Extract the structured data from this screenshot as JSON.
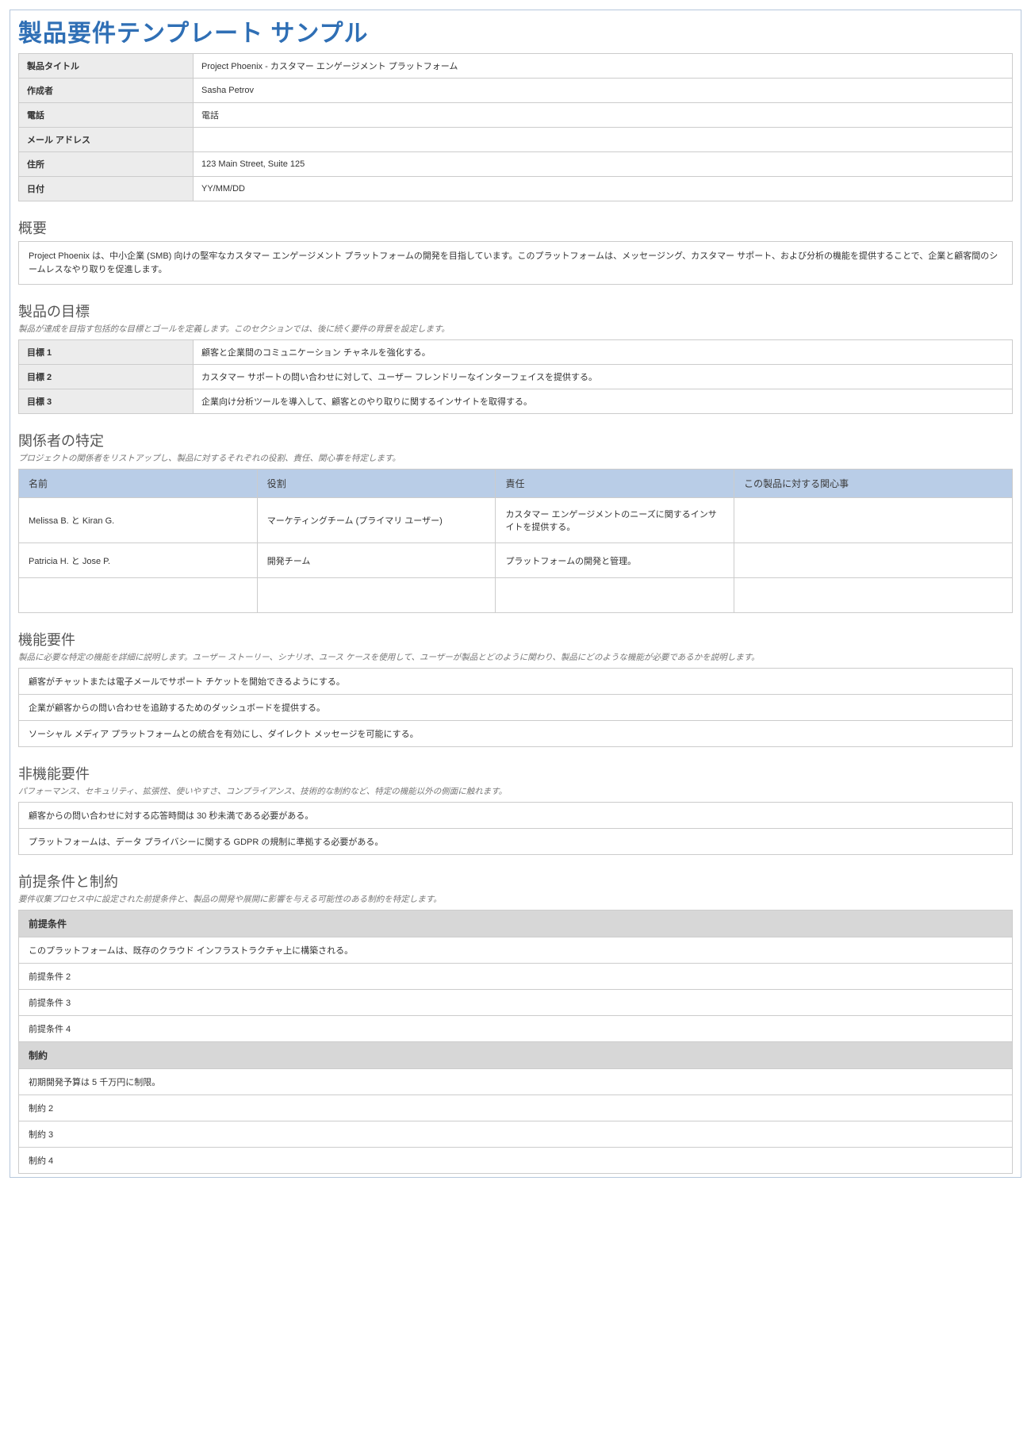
{
  "title": "製品要件テンプレート サンプル",
  "meta": {
    "labels": {
      "product_title": "製品タイトル",
      "author": "作成者",
      "phone": "電話",
      "email": "メール アドレス",
      "address": "住所",
      "date": "日付"
    },
    "values": {
      "product_title": "Project Phoenix - カスタマー エンゲージメント プラットフォーム",
      "author": "Sasha Petrov",
      "phone": "電話",
      "email": "",
      "address": "123 Main Street, Suite 125",
      "date": "YY/MM/DD"
    }
  },
  "overview": {
    "heading": "概要",
    "body": "Project Phoenix は、中小企業 (SMB) 向けの堅牢なカスタマー エンゲージメント プラットフォームの開発を目指しています。このプラットフォームは、メッセージング、カスタマー サポート、および分析の機能を提供することで、企業と顧客間のシームレスなやり取りを促進します。"
  },
  "goals": {
    "heading": "製品の目標",
    "note": "製品が達成を目指す包括的な目標とゴールを定義します。このセクションでは、後に続く要件の背景を設定します。",
    "rows": [
      {
        "label": "目標 1",
        "text": "顧客と企業間のコミュニケーション チャネルを強化する。"
      },
      {
        "label": "目標 2",
        "text": "カスタマー サポートの問い合わせに対して、ユーザー フレンドリーなインターフェイスを提供する。"
      },
      {
        "label": "目標 3",
        "text": "企業向け分析ツールを導入して、顧客とのやり取りに関するインサイトを取得する。"
      }
    ]
  },
  "stakeholders": {
    "heading": "関係者の特定",
    "note": "プロジェクトの関係者をリストアップし、製品に対するそれぞれの役割、責任、関心事を特定します。",
    "columns": {
      "name": "名前",
      "role": "役割",
      "responsibility": "責任",
      "interest": "この製品に対する関心事"
    },
    "rows": [
      {
        "name": "Melissa B. と Kiran G.",
        "role": "マーケティングチーム (プライマリ ユーザー)",
        "responsibility": "カスタマー エンゲージメントのニーズに関するインサイトを提供する。",
        "interest": ""
      },
      {
        "name": "Patricia H. と Jose P.",
        "role": "開発チーム",
        "responsibility": "プラットフォームの開発と管理。",
        "interest": ""
      },
      {
        "name": "",
        "role": "",
        "responsibility": "",
        "interest": ""
      }
    ]
  },
  "functional": {
    "heading": "機能要件",
    "note": "製品に必要な特定の機能を詳細に説明します。ユーザー ストーリー、シナリオ、ユース ケースを使用して、ユーザーが製品とどのように関わり、製品にどのような機能が必要であるかを説明します。",
    "items": [
      "顧客がチャットまたは電子メールでサポート チケットを開始できるようにする。",
      "企業が顧客からの問い合わせを追跡するためのダッシュボードを提供する。",
      "ソーシャル メディア プラットフォームとの統合を有効にし、ダイレクト メッセージを可能にする。"
    ]
  },
  "nonfunctional": {
    "heading": "非機能要件",
    "note": "パフォーマンス、セキュリティ、拡張性、使いやすさ、コンプライアンス、技術的な制約など、特定の機能以外の側面に触れます。",
    "items": [
      "顧客からの問い合わせに対する応答時間は 30 秒未満である必要がある。",
      "プラットフォームは、データ プライバシーに関する GDPR の規制に準拠する必要がある。"
    ]
  },
  "assumptions": {
    "heading": "前提条件と制約",
    "note": "要件収集プロセス中に設定された前提条件と、製品の開発や展開に影響を与える可能性のある制約を特定します。",
    "assumption_header": "前提条件",
    "assumption_items": [
      "このプラットフォームは、既存のクラウド インフラストラクチャ上に構築される。",
      "前提条件 2",
      "前提条件 3",
      "前提条件 4"
    ],
    "constraint_header": "制約",
    "constraint_items": [
      "初期開発予算は 5 千万円に制限。",
      "制約 2",
      "制約 3",
      "制約 4"
    ]
  }
}
